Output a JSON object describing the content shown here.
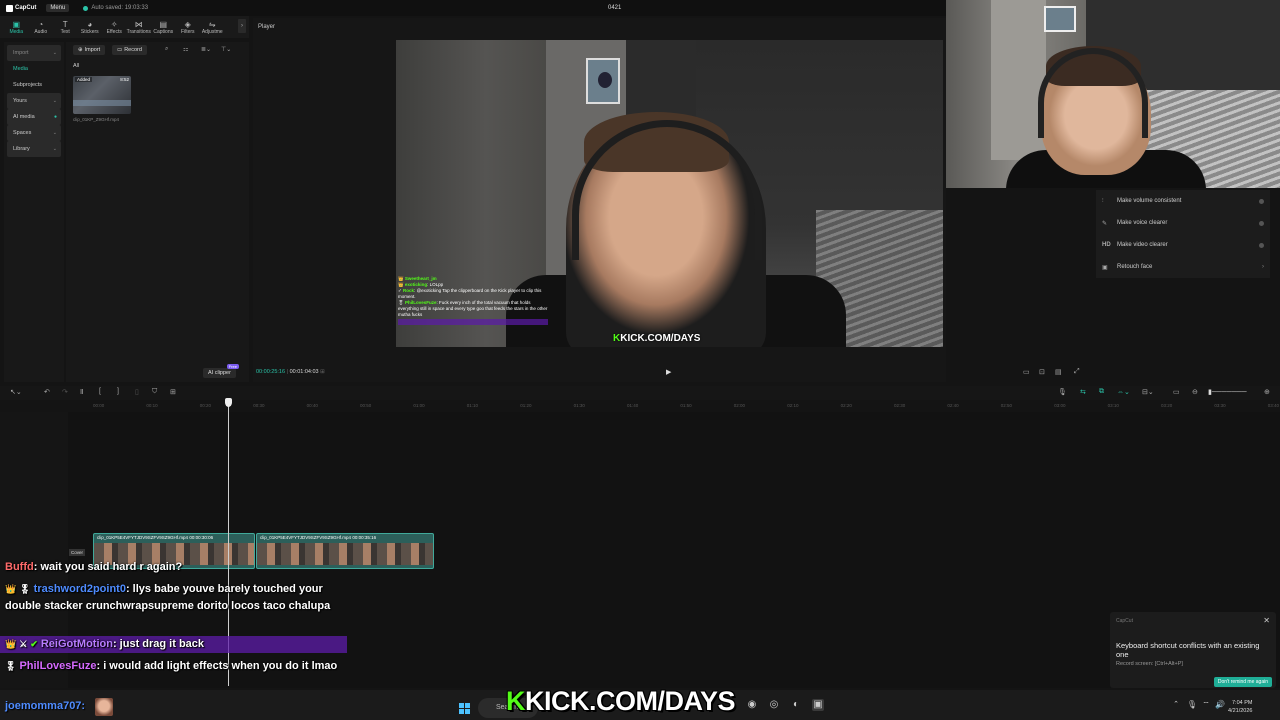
{
  "app": {
    "name": "CapCut",
    "menu_label": "Menu",
    "autosave": "Auto saved: 19:03:33",
    "project_title": "0421"
  },
  "toolbar": {
    "tabs": [
      {
        "label": "Media",
        "icon": "media-icon",
        "active": true
      },
      {
        "label": "Audio",
        "icon": "audio-icon"
      },
      {
        "label": "Text",
        "icon": "text-icon"
      },
      {
        "label": "Stickers",
        "icon": "stickers-icon"
      },
      {
        "label": "Effects",
        "icon": "effects-icon"
      },
      {
        "label": "Transitions",
        "icon": "transitions-icon"
      },
      {
        "label": "Captions",
        "icon": "captions-icon"
      },
      {
        "label": "Filters",
        "icon": "filters-icon"
      },
      {
        "label": "Adjustme",
        "icon": "adjustment-icon"
      }
    ]
  },
  "leftnav": {
    "items": [
      "Import",
      "Media",
      "Subprojects",
      "Yours",
      "AI media",
      "Spaces",
      "Library"
    ]
  },
  "media": {
    "import_label": "Import",
    "record_label": "Record",
    "filter_all": "All",
    "thumb_badge": "Added",
    "thumb_duration": "8:52",
    "thumb_name": "clip_01KP_Z9GHf.mp4",
    "ai_clipper": "AI clipper",
    "ai_clipper_badge": "Free"
  },
  "player": {
    "title": "Player",
    "current_time": "00:00:25:16",
    "total_time": "00:01:04:03",
    "overlay_chat": [
      {
        "user": "Sweetheart_jm",
        "text": ""
      },
      {
        "user": "exoticking",
        "text": "LOLpp"
      },
      {
        "user": "Rock",
        "text": "@exoticking Tap the clipperboard on the Kick player to clip this moment."
      },
      {
        "user": "PhilLovesFuze",
        "text": "Fuck every inch of the total vacuum that holds everything still in space and every type goo that feeds the stars in the other mutha fucks"
      }
    ],
    "watermark_k": "K",
    "watermark_text": "KICK.COM/DAYS"
  },
  "ai_panel": {
    "items": [
      {
        "label": "Make volume consistent",
        "icon": "volume-icon"
      },
      {
        "label": "Make voice clearer",
        "icon": "voice-icon"
      },
      {
        "label": "Make video clearer",
        "icon": "hd-icon"
      },
      {
        "label": "Retouch face",
        "icon": "face-icon"
      }
    ]
  },
  "timeline": {
    "ruler": [
      "00:00",
      "00:10",
      "00:20",
      "00:30",
      "00:40",
      "00:50",
      "01:00",
      "01:10",
      "01:20",
      "01:30",
      "01:40",
      "01:50",
      "02:00",
      "02:10",
      "02:20",
      "02:30",
      "02:40",
      "02:50",
      "03:00",
      "03:10",
      "03:20",
      "03:30",
      "03:40"
    ],
    "clips": [
      {
        "name": "clip_01KP5E4VFYTJDV9SZFV9SZ9GHf.mp4",
        "duration": "00:00:30:06"
      },
      {
        "name": "clip_01KP5E4VFYTJDV9SZFV9SZ9GHf.mp4",
        "duration": "00:00:35:16"
      }
    ],
    "cover_label": "Cover"
  },
  "chat": {
    "messages": [
      {
        "user": "Buffd",
        "text": ": wait you said hard r again?",
        "color": "#ff6b6b"
      },
      {
        "user": "trashword2point0",
        "text": ": llys babe youve barely touched your double stacker crunchwrapsupreme dorito locos taco chalupa",
        "color": "#4f8cff"
      },
      {
        "user": "ReiGotMotion",
        "text": ": just drag it back",
        "color": "#b87dff"
      },
      {
        "user": "PhilLovesFuze",
        "text": ": i would add light effects when you do it lmao",
        "color": "#d66bff"
      }
    ],
    "last_user": "joemomma707:"
  },
  "toast": {
    "app": "CapCut",
    "title": "Keyboard shortcut conflicts with an existing one",
    "subtitle": "Record screen: [Ctrl+Alt+P]",
    "button": "Don't remind me again"
  },
  "taskbar": {
    "search": "Search",
    "big_k": "K",
    "big_watermark": "KICK.COM/DAYS",
    "time": "7:04 PM",
    "date": "4/21/2026"
  },
  "colors": {
    "accent": "#2bc3a8",
    "kick_green": "#53fc18",
    "highlight": "#5d1caa"
  }
}
